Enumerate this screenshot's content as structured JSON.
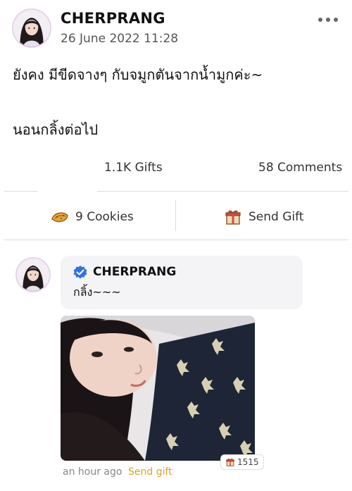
{
  "post": {
    "author": "CHERPRANG",
    "timestamp": "26 June 2022 11:28",
    "body_line1": "ยังคง มีขีดจางๆ กับจมูกตันจากน้ำมูกค่ะ~",
    "body_line2": "นอนกลิ้งต่อไป"
  },
  "stats": {
    "gifts": "1.1K Gifts",
    "comments": "58 Comments"
  },
  "actions": {
    "cookies_label": "9 Cookies",
    "send_gift_label": "Send Gift"
  },
  "comment": {
    "author": "CHERPRANG",
    "text": "กลิ้ง~~~",
    "time": "an hour ago",
    "send_gift_label": "Send gift",
    "gift_count": "1515"
  },
  "colors": {
    "verified_badge": "#2f73e0",
    "gift_link": "#e0a226",
    "divider": "#dcdcdc"
  },
  "icons": {
    "more": "more-icon",
    "cookie": "cookie-icon",
    "gift": "gift-icon",
    "verified": "verified-badge-icon"
  }
}
